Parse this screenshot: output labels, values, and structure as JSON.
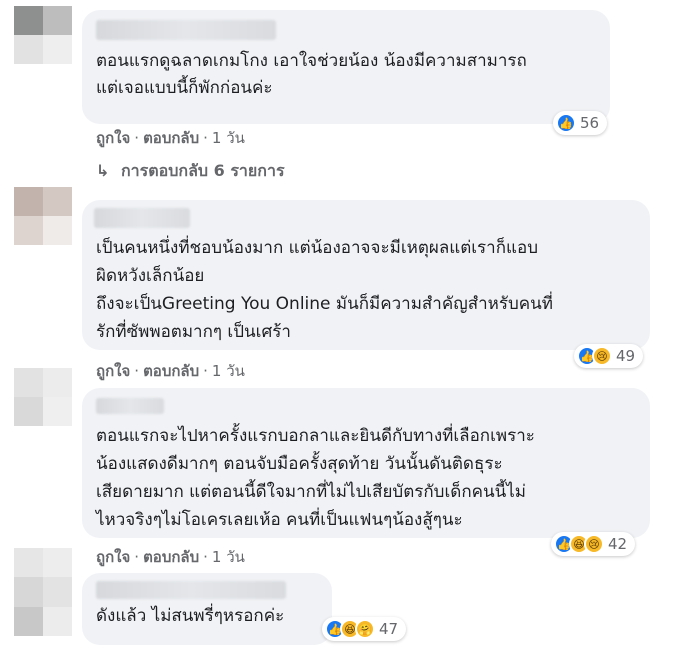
{
  "comments": [
    {
      "text_lines": [
        "ตอนแรกดูฉลาดเกมโกง เอาใจช่วยน้อง น้องมีความสามารถ",
        "แต่เจอแบบนี้ก็พักก่อนค่ะ"
      ],
      "like_label": "ถูกใจ",
      "reply_label": "ตอบกลับ",
      "time": "1 วัน",
      "reaction_icons": [
        "like-icon"
      ],
      "reaction_count": "56",
      "replies_label": "การตอบกลับ 6 รายการ"
    },
    {
      "text_lines": [
        "เป็นคนหนึ่งที่ชอบน้องมาก แต่น้องอาจจะมีเหตุผลแต่เราก็แอบ",
        "ผิดหวังเล็กน้อย",
        "ถึงจะเป็นGreeting You Online มันก็มีความสำคัญสำหรับคนที่",
        "รักที่ซัพพอตมากๆ เป็นเศร้า"
      ],
      "like_label": "ถูกใจ",
      "reply_label": "ตอบกลับ",
      "time": "1 วัน",
      "reaction_icons": [
        "like-icon",
        "sad-icon"
      ],
      "reaction_count": "49"
    },
    {
      "text_lines": [
        "ตอนแรกจะไปหาครั้งแรกบอกลาและยินดีกับทางที่เลือกเพราะ",
        "น้องแสดงดีมากๆ ตอนจับมือครั้งสุดท้าย วันนั้นดันติดธุระ",
        "เสียดายมาก แต่ตอนนี้ดีใจมากที่ไม่ไปเสียบัตรกับเด็กคนนี้ไม่",
        "ไหวจริงๆไม่โอเครเลยเห้อ คนที่เป็นแฟนๆน้องสู้ๆนะ"
      ],
      "like_label": "ถูกใจ",
      "reply_label": "ตอบกลับ",
      "time": "1 วัน",
      "reaction_icons": [
        "like-icon",
        "haha-icon",
        "sad-icon"
      ],
      "reaction_count": "42"
    },
    {
      "text_lines": [
        "ดังแล้ว ไม่สนพรี่ๆหรอกค่ะ"
      ],
      "reaction_icons": [
        "like-icon",
        "haha-icon",
        "care-icon"
      ],
      "reaction_count": "47"
    }
  ]
}
